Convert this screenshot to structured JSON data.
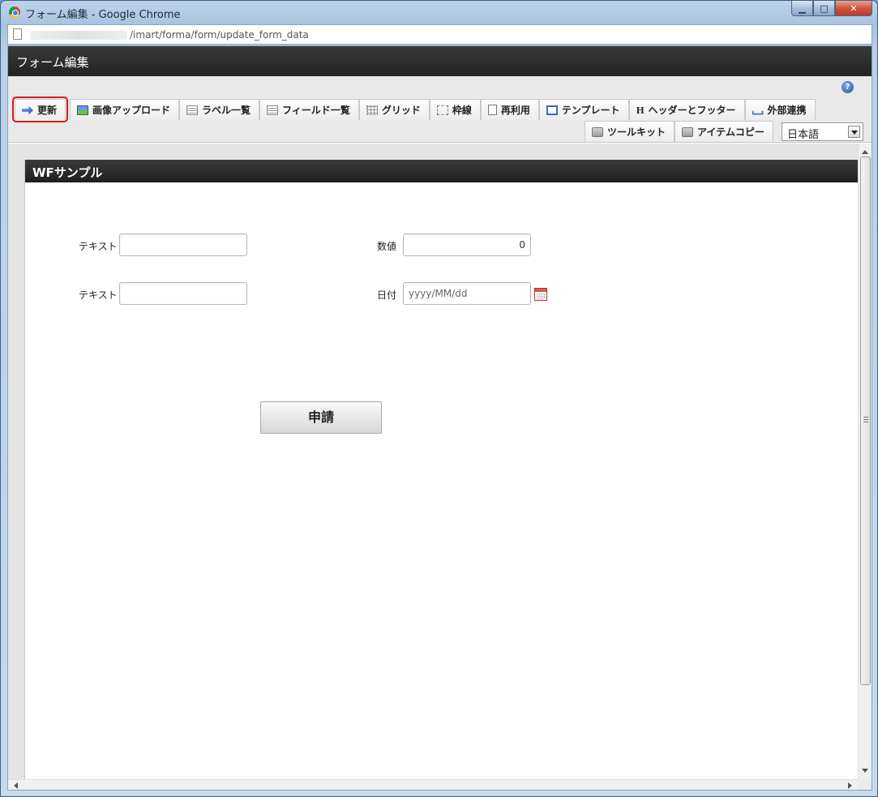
{
  "window": {
    "title": "フォーム編集 - Google Chrome",
    "minimize": "▁",
    "maximize": "□",
    "close": "✕"
  },
  "address": {
    "url": "/imart/forma/form/update_form_data"
  },
  "app": {
    "title": "フォーム編集",
    "help": "?"
  },
  "toolbar": {
    "row1": [
      {
        "label": "更新",
        "icon": "update-icon"
      },
      {
        "label": "画像アップロード",
        "icon": "image-upload-icon"
      },
      {
        "label": "ラベル一覧",
        "icon": "list-icon"
      },
      {
        "label": "フィールド一覧",
        "icon": "list-icon"
      },
      {
        "label": "グリッド",
        "icon": "grid-icon"
      },
      {
        "label": "枠線",
        "icon": "frame-icon"
      },
      {
        "label": "再利用",
        "icon": "document-icon"
      },
      {
        "label": "テンプレート",
        "icon": "template-icon"
      },
      {
        "label": "ヘッダーとフッター",
        "icon": "h-icon"
      },
      {
        "label": "外部連携",
        "icon": "share-icon"
      }
    ],
    "row2": [
      {
        "label": "ツールキット",
        "icon": "toolbox-icon"
      },
      {
        "label": "アイテムコピー",
        "icon": "toolbox-icon"
      }
    ],
    "language": "日本語"
  },
  "form": {
    "title": "WFサンプル",
    "fields": {
      "text1_label": "テキスト",
      "text1_value": "",
      "text2_label": "テキスト",
      "text2_value": "",
      "number_label": "数値",
      "number_value": "0",
      "date_label": "日付",
      "date_placeholder": "yyyy/MM/dd"
    },
    "submit_label": "申請"
  },
  "colors": {
    "highlight": "#d11e1e",
    "header": "#2a2a2a"
  }
}
